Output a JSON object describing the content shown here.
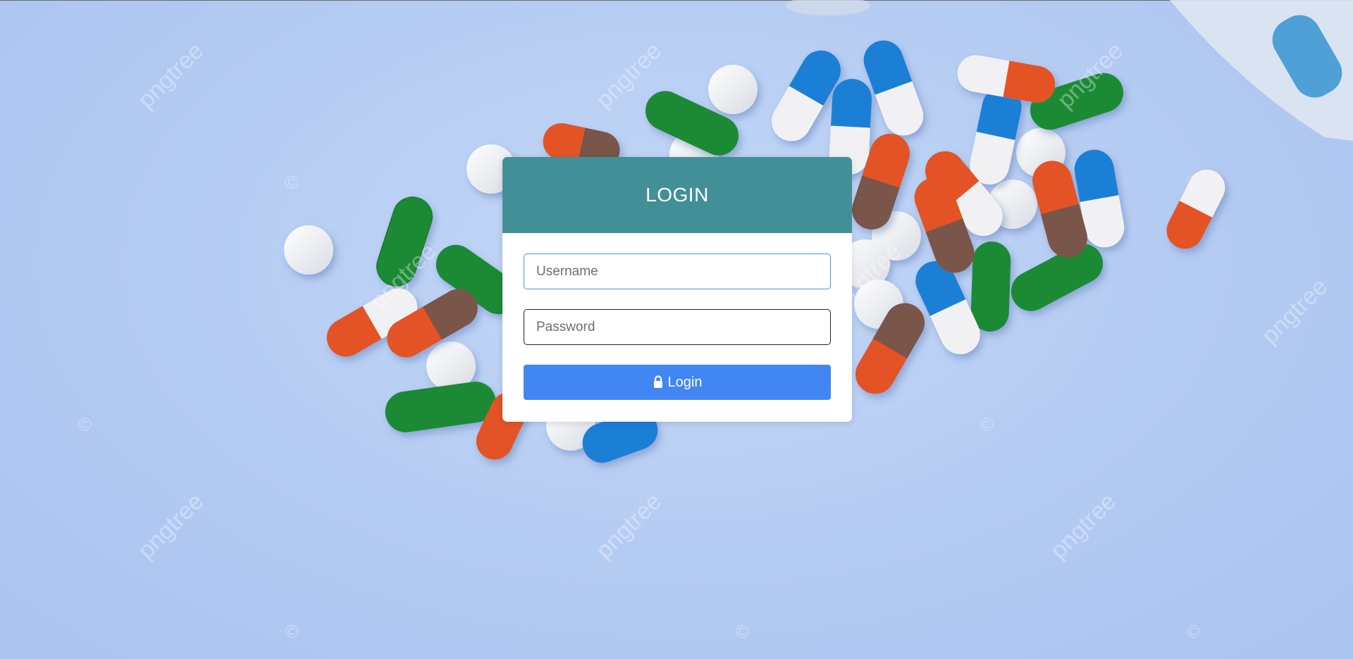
{
  "login": {
    "title": "LOGIN",
    "username_placeholder": "Username",
    "password_placeholder": "Password",
    "button_label": "Login",
    "button_icon": "lock-icon"
  },
  "colors": {
    "header": "#438f97",
    "button": "#4286f4",
    "focus_border": "#4f8ff0",
    "background": "#b7cff5"
  },
  "background": {
    "watermark_text": "pngtree",
    "watermark_symbol": "©"
  }
}
